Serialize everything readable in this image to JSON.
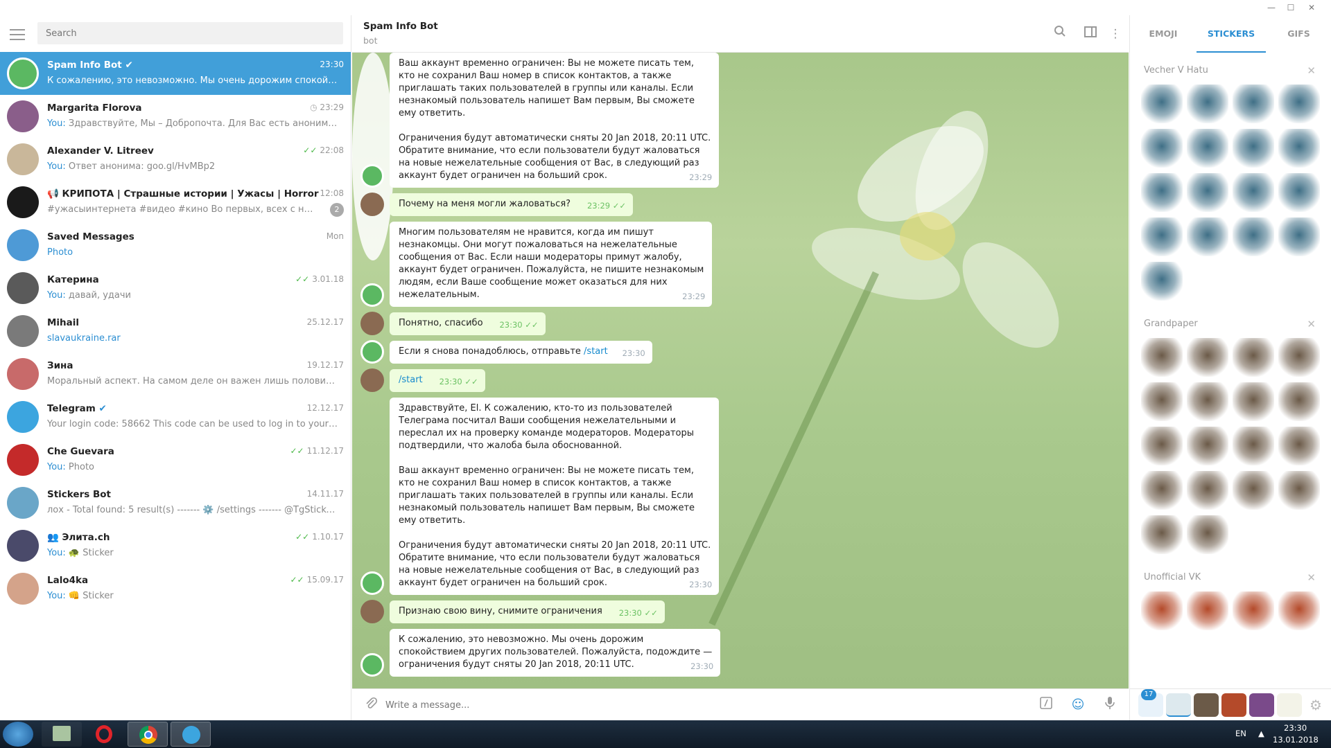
{
  "window": {
    "min": "—",
    "max": "☐",
    "close": "✕"
  },
  "sidebar": {
    "search_placeholder": "Search",
    "chats": [
      {
        "name": "Spam Info Bot",
        "verified": true,
        "time": "23:30",
        "you": "",
        "msg": "К сожалению, это невозможно. Мы очень дорожим спокойствием других пользователей.",
        "color": "#5bb862",
        "active": true,
        "icon": "bot-icon"
      },
      {
        "name": "Margarita Florova",
        "time": "23:29",
        "clock": true,
        "you": "You:",
        "msg": " Здравствуйте, Мы – Добропочта. Для Вас есть анонимное письмо",
        "color": "#8a5e8a"
      },
      {
        "name": "Alexander V. Litreev",
        "time": "22:08",
        "ticks": true,
        "you": "You:",
        "msg": " Ответ анонима: goo.gl/HvMBp2",
        "color": "#c9b79a"
      },
      {
        "name": "📢 КРИПОТА | Страшные истории | Ужасы | Horror",
        "time": "12:08",
        "you": "",
        "msg": "#ужасыинтернета #видео #кино  Во первых, всех с началом выходных",
        "badge": "2",
        "color": "#1a1a1a"
      },
      {
        "name": "Saved Messages",
        "time": "Mon",
        "you": "",
        "msg": "Photo",
        "msgcolor": "#2b8ed2",
        "color": "#4e9ad6",
        "icon": "bookmark-icon"
      },
      {
        "name": "Катерина",
        "time": "3.01.18",
        "ticks": true,
        "you": "You:",
        "msg": " давай, удачи",
        "color": "#5a5a5a"
      },
      {
        "name": "Mihail",
        "time": "25.12.17",
        "you": "",
        "msg": "slavaukraine.rar",
        "msgcolor": "#2b8ed2",
        "color": "#7a7a7a"
      },
      {
        "name": "Зина",
        "time": "19.12.17",
        "you": "",
        "msg": "Моральный аспект.   На самом деле он важен лишь половине тех, кто",
        "color": "#c86a6a"
      },
      {
        "name": "Telegram",
        "verified": true,
        "time": "12.12.17",
        "you": "",
        "msg": "Your login code: 58662  This code can be used to log in to your Telegram account",
        "color": "#3ca5df",
        "icon": "telegram-icon"
      },
      {
        "name": "Che Guevara",
        "time": "11.12.17",
        "ticks": true,
        "you": "You:",
        "msg": " Photo",
        "color": "#c42a2a"
      },
      {
        "name": "Stickers Bot",
        "time": "14.11.17",
        "you": "",
        "msg": "лох - Total found: 5 result(s) ------- ⚙️ /settings ------- @TgSticker - Sticker search",
        "color": "#6aa6c8"
      },
      {
        "name": "Элита.ch",
        "group": true,
        "time": "1.10.17",
        "ticks": true,
        "you": "You:",
        "msg": " 🐢 Sticker",
        "color": "#4a4a6a"
      },
      {
        "name": "Lalo4ka",
        "time": "15.09.17",
        "ticks": true,
        "you": "You:",
        "msg": " 👊 Sticker",
        "color": "#d4a38a"
      }
    ]
  },
  "header": {
    "title": "Spam Info Bot",
    "subtitle": "bot"
  },
  "messages": [
    {
      "who": "in",
      "top": 0,
      "text": "Ваш аккаунт временно ограничен: Вы не можете писать тем,\nкто не сохранил Ваш номер в список контактов, а также\nприглашать таких пользователей в группы или каналы. Если\nнезнакомый пользователь напишет Вам первым, Вы сможете\nему ответить.\n\nОграничения будут автоматически сняты 20 Jan 2018, 20:11 UTC.\nОбратите внимание, что если пользователи будут жаловаться\nна новые нежелательные сообщения от Вас, в следующий раз\nаккаунт будет ограничен на больший срок.",
      "time": "23:29"
    },
    {
      "who": "out",
      "text": "Почему на меня могли жаловаться?",
      "time": "23:29"
    },
    {
      "who": "in",
      "text": "Многим пользователям не нравится, когда им пишут\nнезнакомцы. Они могут пожаловаться на нежелательные\nсообщения от Вас. Если наши модераторы примут жалобу,\nаккаунт будет ограничен. Пожалуйста, не пишите незнакомым\nлюдям, если Ваше сообщение может оказаться для них\nнежелательным.",
      "time": "23:29"
    },
    {
      "who": "out",
      "text": "Понятно, спасибо",
      "time": "23:30"
    },
    {
      "who": "in",
      "text": "Если я снова понадоблюсь, отправьте ",
      "link": "/start",
      "time": "23:30"
    },
    {
      "who": "out",
      "text": "",
      "link": "/start",
      "time": "23:30"
    },
    {
      "who": "in",
      "text": "Здравствуйте, El. К сожалению, кто-то из пользователей\nТелеграма посчитал Ваши сообщения нежелательными и\nпереслал их на проверку команде модераторов. Модераторы\nподтвердили, что жалоба была обоснованной.\n\nВаш аккаунт временно ограничен: Вы не можете писать тем,\nкто не сохранил Ваш номер в список контактов, а также\nприглашать таких пользователей в группы или каналы. Если\nнезнакомый пользователь напишет Вам первым, Вы сможете\nему ответить.\n\nОграничения будут автоматически сняты 20 Jan 2018, 20:11 UTC.\nОбратите внимание, что если пользователи будут жаловаться\nна новые нежелательные сообщения от Вас, в следующий раз\nаккаунт будет ограничен на больший срок.",
      "time": "23:30"
    },
    {
      "who": "out",
      "text": "Признаю свою вину, снимите ограничения",
      "time": "23:30"
    },
    {
      "who": "in",
      "text": "К сожалению, это невозможно. Мы очень дорожим\nспокойствием других пользователей. Пожалуйста, подождите —\nограничения будут сняты 20 Jan 2018, 20:11 UTC.",
      "time": "23:30"
    }
  ],
  "compose": {
    "placeholder": "Write a message..."
  },
  "stickers": {
    "tabs": [
      "EMOJI",
      "STICKERS",
      "GIFS"
    ],
    "active_tab": 1,
    "sets": [
      {
        "name": "Vecher V Hatu",
        "count": 17,
        "color": "#3f6f86"
      },
      {
        "name": "Grandpaper",
        "count": 18,
        "color": "#6b5a48"
      },
      {
        "name": "Unofficial VK",
        "count": 4,
        "color": "#b44a2a"
      }
    ],
    "recent_count": "17"
  },
  "taskbar": {
    "lang": "EN",
    "time": "23:30",
    "date": "13.01.2018"
  }
}
